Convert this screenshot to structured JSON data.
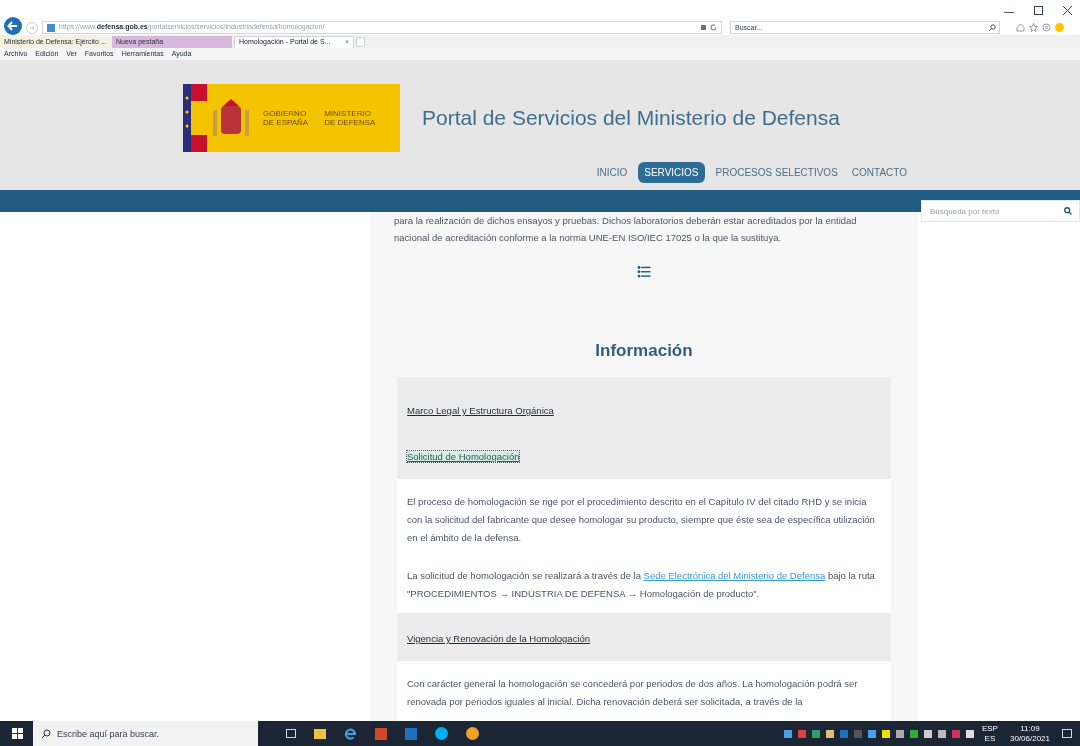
{
  "browser": {
    "url_prefix": "https://www.",
    "url_domain": "defensa.gob.es",
    "url_path": "/portalservicios/servicios/industriadefensa/homologacion/",
    "search_placeholder": "Buscar...",
    "tabs": [
      {
        "label": "Ministerio de Defensa: Ejército ...",
        "selected": false
      },
      {
        "label": "Nueva pestaña",
        "selected": false
      },
      {
        "label": "Homologación - Portal de S...",
        "selected": true
      }
    ],
    "close_tab": "×",
    "menu": [
      "Archivo",
      "Edición",
      "Ver",
      "Favoritos",
      "Herramientas",
      "Ayuda"
    ]
  },
  "header": {
    "logo_left": "GOBIERNO\nDE ESPAÑA",
    "logo_right": "MINISTERIO\nDE DEFENSA",
    "title": "Portal de Servicios del Ministerio de Defensa",
    "nav": [
      {
        "label": "INICIO",
        "selected": false
      },
      {
        "label": "SERVICIOS",
        "selected": true
      },
      {
        "label": "PROCESOS SELECTIVOS",
        "selected": false
      },
      {
        "label": "CONTACTO",
        "selected": false
      }
    ]
  },
  "search": {
    "placeholder": "Búsqueda por texto"
  },
  "intro": "para la realización de dichos ensayos y pruebas. Dichos laboratorios deberán estar acreditados por la entidad nacional de acreditación conforme a la norma UNE-EN ISO/IEC 17025 o la que la sustituya.",
  "section_title": "Información",
  "accordion": [
    {
      "title": "Marco Legal y Estructura Orgánica",
      "selected": false
    },
    {
      "title": "Solicitud de Homologación",
      "selected": true,
      "paragraphs": [
        {
          "text": "El proceso de homologación se rige por el procedimiento descrito en el Capítulo IV del citado RHD y se inicia con la solicitud del fabricante que desee homologar su producto, siempre que éste sea de específica utilización en el ámbito de la defensa."
        },
        {
          "before": "La solicitud de homologación se realizará a través de la ",
          "link": "Sede Electrónica del Ministerio de Defensa",
          "after": " bajo la ruta \"PROCEDIMIENTOS → INDUSTRIA DE DEFENSA → Homologación de producto\"."
        }
      ]
    },
    {
      "title": "Vigencia y Renovación de la Homologación",
      "selected": false,
      "paragraphs": [
        {
          "text": "Con carácter general la homologación se concederá por periodos de dos años. La homologación podrá ser renovada por periodos iguales al inicial. Dicha renovación deberá ser solicitada, a través de la"
        }
      ]
    }
  ],
  "taskbar": {
    "search_placeholder": "Escribe aquí para buscar.",
    "lang": "ESP",
    "lang_sub": "ES",
    "time": "11:09",
    "date": "30/06/2021"
  }
}
